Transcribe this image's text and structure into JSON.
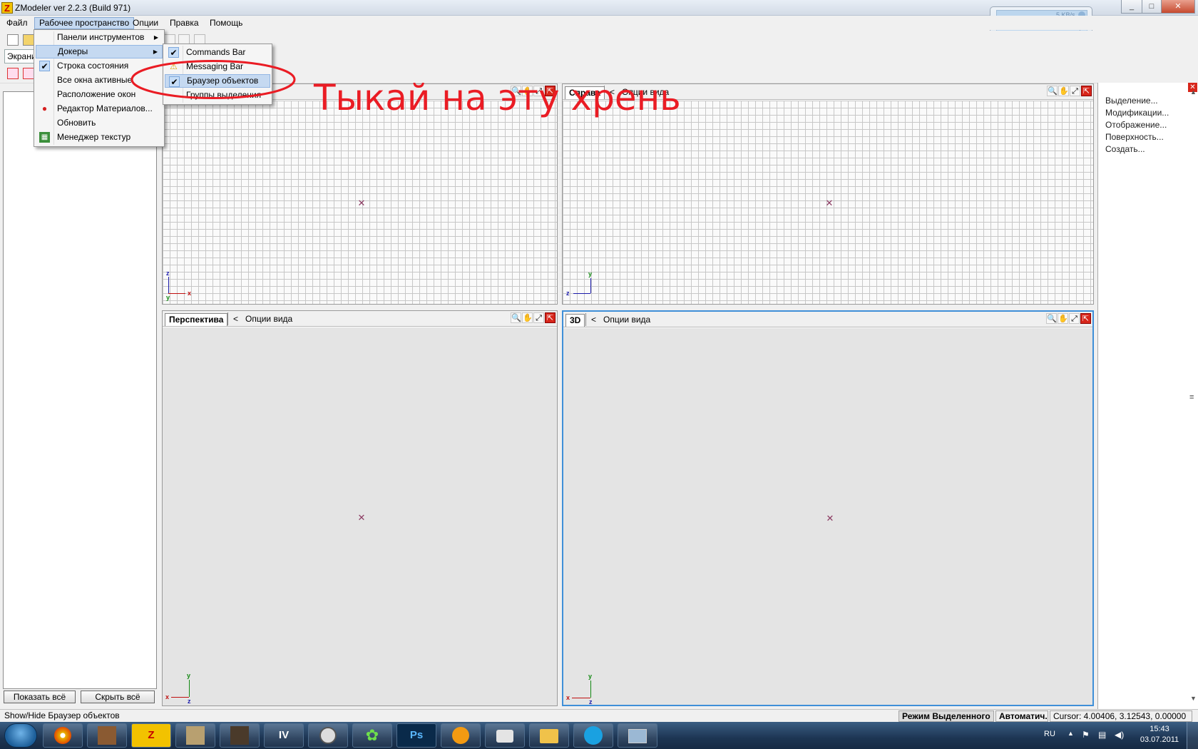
{
  "window": {
    "title": "ZModeler ver 2.2.3 (Build 971)",
    "app_icon_letter": "Z",
    "controls": [
      "_",
      "□",
      "✕"
    ]
  },
  "menubar": [
    "Файл",
    "Рабочее пространство",
    "Опции",
    "Правка",
    "Помощь"
  ],
  "toolbar": {
    "workspace_combo": "Экрани"
  },
  "workspace_menu": {
    "items": [
      {
        "label": "Панели инструментов",
        "submenu": true
      },
      {
        "label": "Докеры",
        "submenu": true,
        "highlighted": true
      },
      {
        "label": "Строка состояния",
        "checked": true
      },
      {
        "label": "Все окна активные"
      },
      {
        "label": "Расположение окон"
      },
      {
        "label": "Редактор Материалов...",
        "icon": "material-ball-icon"
      },
      {
        "label": "Обновить"
      },
      {
        "label": "Менеджер текстур",
        "icon": "texture-icon"
      }
    ]
  },
  "dockers_menu": {
    "items": [
      {
        "label": "Commands Bar",
        "checked": true
      },
      {
        "label": "Messaging Bar",
        "icon": "warning-icon"
      },
      {
        "label": "Браузер объектов",
        "checked": true,
        "highlighted": true
      },
      {
        "label": "Группы выделения"
      }
    ]
  },
  "annotation": {
    "text": "Тыкай на эту хрень",
    "color": "#ea1c24"
  },
  "left_panel": {
    "show_all": "Показать всё",
    "hide_all": "Скрыть всё"
  },
  "viewports": [
    {
      "tab": "",
      "options": "",
      "axis_v": "z",
      "axis_h": "x",
      "axis_origin": "y",
      "grid": true
    },
    {
      "tab": "Справа",
      "options": "Опции вида",
      "axis_v": "y",
      "axis_h": "z",
      "axis_origin": "z",
      "grid": true
    },
    {
      "tab": "Перспектива",
      "options": "Опции вида",
      "axis_v": "y",
      "axis_h": "z",
      "axis_origin": "x",
      "grid": false
    },
    {
      "tab": "3D",
      "options": "Опции вида",
      "axis_v": "y",
      "axis_h": "z",
      "axis_origin": "x",
      "grid": false
    }
  ],
  "right_panel": {
    "items": [
      "Выделение...",
      "Модификации...",
      "Отображение...",
      "Поверхность...",
      "Создать..."
    ]
  },
  "statusbar": {
    "hint": "Show/Hide Браузер объектов",
    "mode": "Режим Выделенного",
    "auto": "Автоматич.",
    "cursor": "Cursor: 4.00406, 3.12543, 0.00000"
  },
  "network_widget": {
    "speed": "5 KB/s"
  },
  "taskbar": {
    "apps": [
      "browser",
      "gta-character",
      "zmodeler",
      "game-character",
      "gta-iv-character",
      "IV",
      "half-life",
      "icq",
      "Ps",
      "aimp",
      "camera",
      "explorer",
      "skype",
      "network"
    ],
    "language": "RU",
    "time": "15:43",
    "date": "03.07.2011"
  }
}
